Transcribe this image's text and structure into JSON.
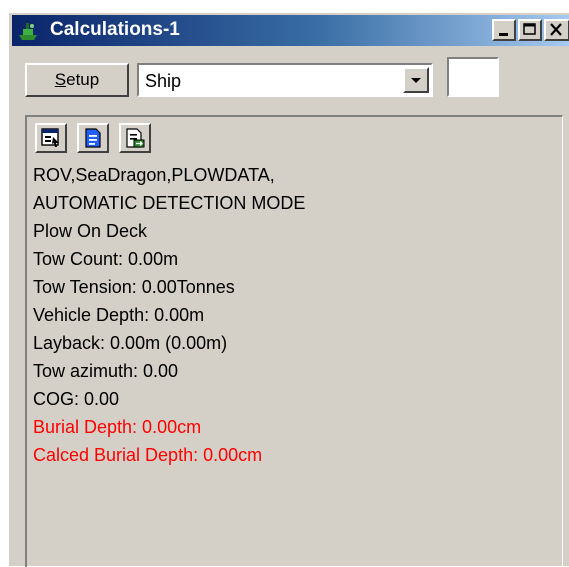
{
  "window": {
    "title": "Calculations-1",
    "app_icon": "ship-icon",
    "caption_buttons": [
      "minimize-icon",
      "maximize-icon",
      "close-icon"
    ]
  },
  "toolbar": {
    "setup_label_underlined": "S",
    "setup_label_rest": "etup",
    "selected_source": "Ship",
    "dropdown_icon": "chevron-down-icon"
  },
  "panel": {
    "icons": [
      "properties-icon",
      "document-icon",
      "export-icon"
    ],
    "lines": [
      {
        "text": "ROV,SeaDragon,PLOWDATA,",
        "color": "#000000"
      },
      {
        "text": "AUTOMATIC DETECTION MODE",
        "color": "#000000"
      },
      {
        "text": "Plow On Deck",
        "color": "#000000"
      },
      {
        "text": "Tow Count: 0.00m",
        "color": "#000000"
      },
      {
        "text": "Tow Tension: 0.00Tonnes",
        "color": "#000000"
      },
      {
        "text": "Vehicle Depth: 0.00m",
        "color": "#000000"
      },
      {
        "text": "Layback: 0.00m (0.00m)",
        "color": "#000000"
      },
      {
        "text": "Tow azimuth: 0.00",
        "color": "#000000"
      },
      {
        "text": "COG: 0.00",
        "color": "#000000"
      },
      {
        "text": "Burial Depth: 0.00cm",
        "color": "#ff0000"
      },
      {
        "text": "Calced Burial Depth: 0.00cm",
        "color": "#ff0000"
      }
    ]
  },
  "colors": {
    "titlebar_start": "#0a246a",
    "titlebar_end": "#a6caf0",
    "face": "#d4d0c8",
    "alert": "#ff0000"
  }
}
